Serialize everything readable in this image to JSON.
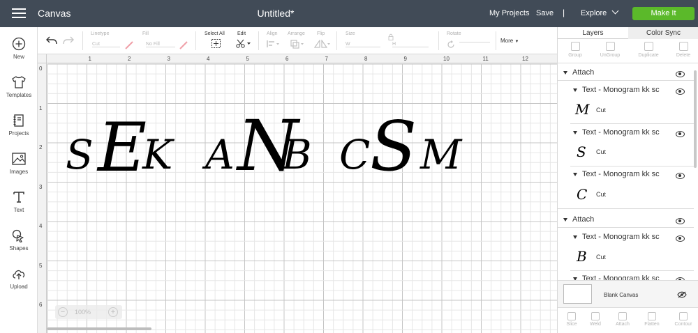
{
  "topbar": {
    "app_title": "Canvas",
    "doc_title": "Untitled*",
    "my_projects": "My Projects",
    "save": "Save",
    "separator": "|",
    "explore": "Explore",
    "make_it": "Make It",
    "make_it_color": "#5bb92a",
    "bg_color": "#414b57"
  },
  "sidebar": {
    "items": [
      {
        "label": "New",
        "icon": "plus-circle-icon"
      },
      {
        "label": "Templates",
        "icon": "tshirt-icon"
      },
      {
        "label": "Projects",
        "icon": "notebook-icon"
      },
      {
        "label": "Images",
        "icon": "image-icon"
      },
      {
        "label": "Text",
        "icon": "text-T-icon"
      },
      {
        "label": "Shapes",
        "icon": "shapes-icon"
      },
      {
        "label": "Upload",
        "icon": "cloud-upload-icon"
      }
    ]
  },
  "toolbar": {
    "linetype_label": "Linetype",
    "linetype_value": "Cut",
    "fill_label": "Fill",
    "fill_value": "No Fill",
    "select_all": "Select All",
    "edit": "Edit",
    "align": "Align",
    "arrange": "Arrange",
    "flip": "Flip",
    "size": "Size",
    "size_w": "W",
    "size_h": "H",
    "rotate": "Rotate",
    "more": "More"
  },
  "canvas": {
    "ruler_top": [
      "1",
      "2",
      "3",
      "4",
      "5",
      "6",
      "7",
      "8",
      "9",
      "10",
      "11",
      "12"
    ],
    "ruler_left": [
      "0",
      "1",
      "2",
      "3",
      "4",
      "5",
      "6"
    ],
    "monograms": [
      {
        "left": "S",
        "center": "E",
        "right": "K"
      },
      {
        "left": "A",
        "center": "N",
        "right": "B"
      },
      {
        "left": "C",
        "center": "S",
        "right": "M"
      }
    ],
    "zoom": "100%"
  },
  "panel": {
    "tab_layers": "Layers",
    "tab_color_sync": "Color Sync",
    "tools": [
      "Group",
      "UnGroup",
      "Duplicate",
      "Delete"
    ],
    "groups": [
      {
        "name": "Attach",
        "layers": [
          {
            "name": "Text - Monogram kk sc",
            "thumb": "M",
            "op": "Cut"
          },
          {
            "name": "Text - Monogram kk sc",
            "thumb": "S",
            "op": "Cut"
          },
          {
            "name": "Text - Monogram kk sc",
            "thumb": "C",
            "op": "Cut"
          }
        ]
      },
      {
        "name": "Attach",
        "layers": [
          {
            "name": "Text - Monogram kk sc",
            "thumb": "B",
            "op": "Cut"
          },
          {
            "name": "Text - Monogram kk sc"
          }
        ]
      }
    ],
    "blank_canvas": "Blank Canvas",
    "bottom_tools": [
      "Slice",
      "Weld",
      "Attach",
      "Flatten",
      "Contour"
    ]
  }
}
